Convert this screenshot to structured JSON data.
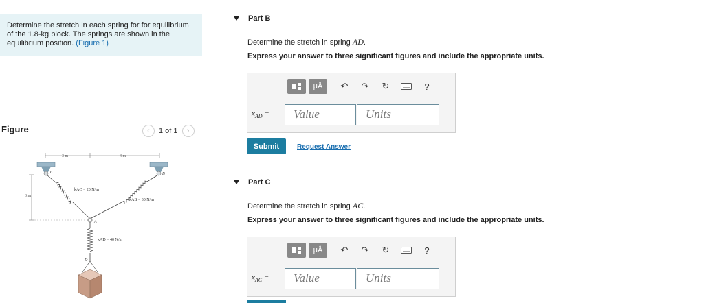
{
  "problem": {
    "text": "Determine the stretch in each spring for for equilibrium of the 1.8-kg block. The springs are shown in the equilibrium position.",
    "figure_link": "(Figure 1)"
  },
  "figure": {
    "title": "Figure",
    "pager": "1 of 1",
    "labels": {
      "dim_3m_top": "3 m",
      "dim_4m": "4 m",
      "dim_3m_side": "3 m",
      "point_c": "C",
      "point_b": "B",
      "point_a": "A",
      "point_d": "D",
      "k_ac": "kAC = 20 N/m",
      "k_ab": "kAB = 30 N/m",
      "k_ad": "kAD = 40 N/m"
    }
  },
  "part_b": {
    "title": "Part B",
    "question_prefix": "Determine the stretch in spring ",
    "question_var": "AD",
    "question_suffix": ".",
    "instruction": "Express your answer to three significant figures and include the appropriate units.",
    "label_main": "x",
    "label_sub": "AD",
    "label_eq": " =",
    "value_placeholder": "Value",
    "units_placeholder": "Units",
    "submit": "Submit",
    "request_answer": "Request Answer"
  },
  "part_c": {
    "title": "Part C",
    "question_prefix": "Determine the stretch in spring ",
    "question_var": "AC",
    "question_suffix": ".",
    "instruction": "Express your answer to three significant figures and include the appropriate units.",
    "label_main": "x",
    "label_sub": "AC",
    "label_eq": " =",
    "value_placeholder": "Value",
    "units_placeholder": "Units"
  },
  "toolbar": {
    "mu_label": "μÅ",
    "help": "?",
    "icons": [
      "templates-icon",
      "symbols-icon",
      "undo-icon",
      "redo-icon",
      "reset-icon",
      "keyboard-icon",
      "help-icon"
    ]
  }
}
